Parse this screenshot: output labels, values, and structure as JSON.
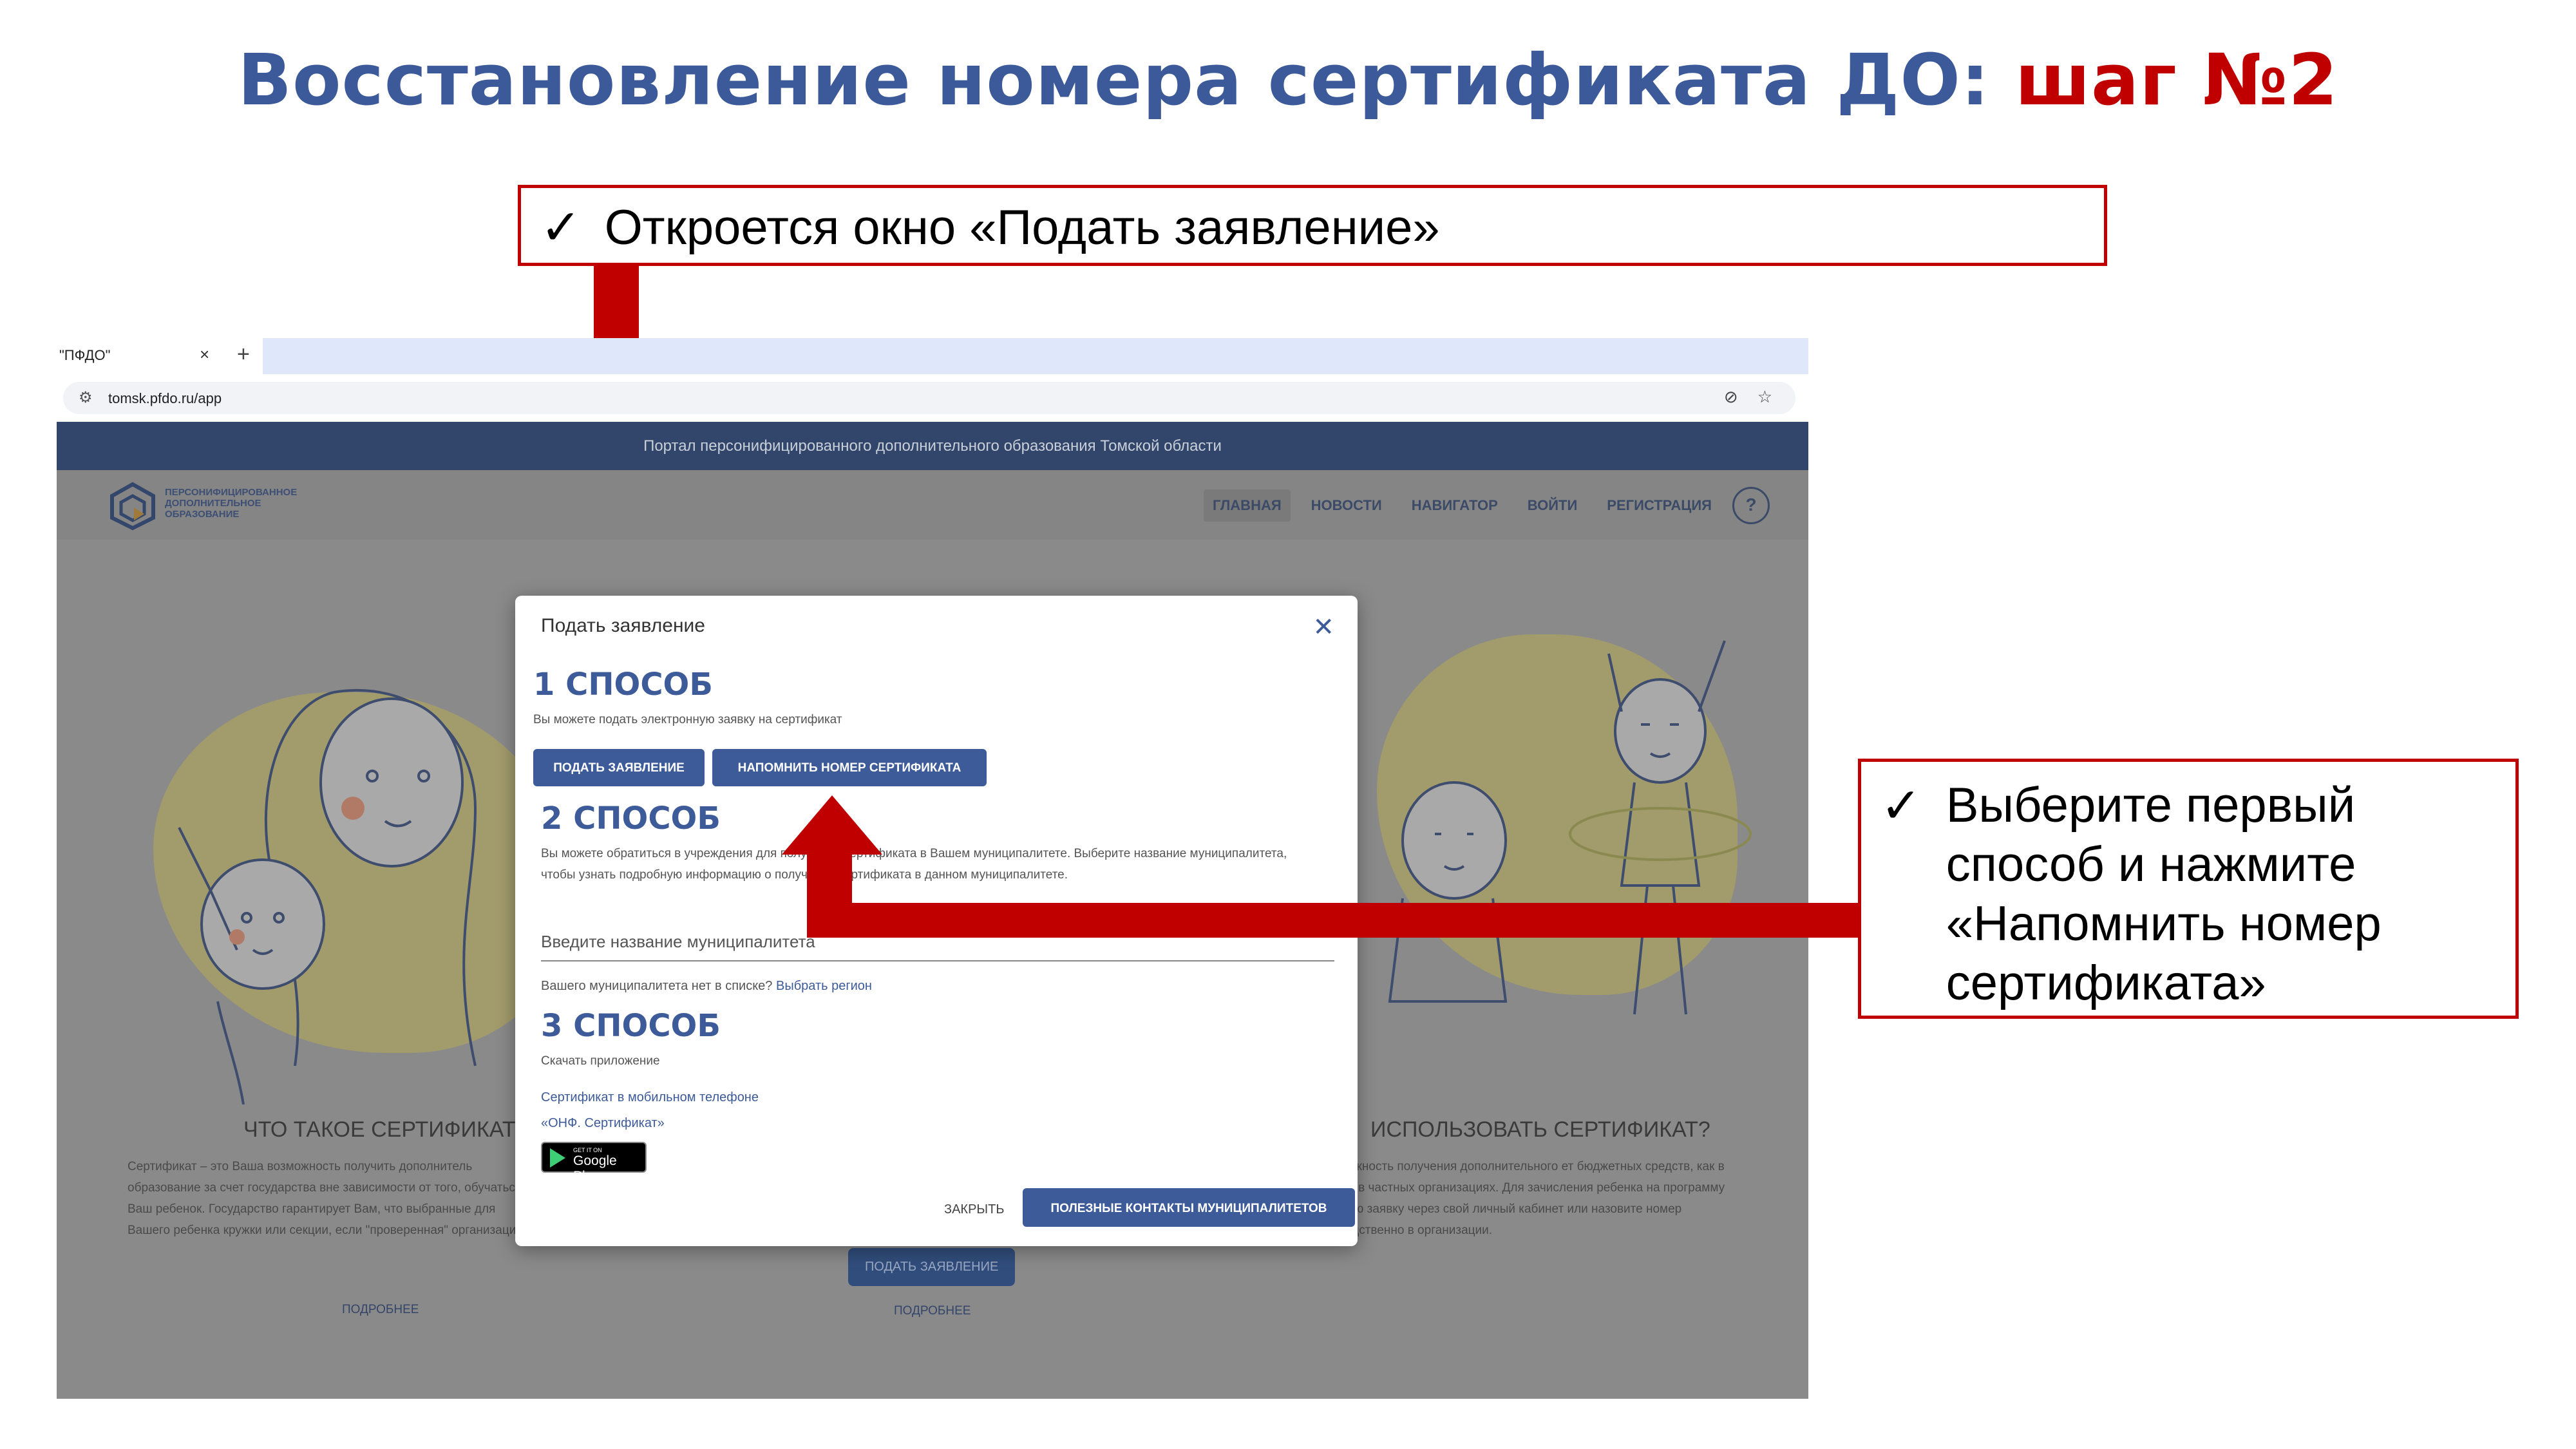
{
  "slide": {
    "title_main": "Восстановление номера сертификата ДО: ",
    "title_accent": "шаг №2",
    "callout_top": "Откроется окно «Подать заявление»",
    "callout_right": "Выберите первый способ и нажмите «Напомнить номер сертификата»",
    "check_mark": "✓",
    "accent_color": "#c00000",
    "title_color": "#3c5a9a"
  },
  "browser": {
    "tab_label": "\"ПФДО\"",
    "tab_close": "×",
    "new_tab": "+",
    "url": "tomsk.pfdo.ru/app"
  },
  "site": {
    "banner": "Портал персонифицированного дополнительного образования Томской области",
    "logo_text": "ПЕРСОНИФИЦИРОВАННОЕ ДОПОЛНИТЕЛЬНОЕ ОБРАЗОВАНИЕ",
    "nav": [
      "ГЛАВНАЯ",
      "НОВОСТИ",
      "НАВИГАТОР",
      "ВОЙТИ",
      "РЕГИСТРАЦИЯ"
    ],
    "help": "?",
    "left_section": {
      "heading": "ЧТО ТАКОЕ СЕРТИФИКАТ?",
      "text": "Сертификат – это Ваша возможность получить дополнитель образование за счет государства вне зависимости от того, обучаться Ваш ребенок. Государство гарантирует Вам, что выбранные для Вашего ребенка кружки или секции, если \"проверенная\" организация.",
      "more": "ПОДРОБНЕЕ"
    },
    "middle_section": {
      "button": "ПОДАТЬ ЗАЯВЛЕНИЕ",
      "more": "ПОДРОБНЕЕ"
    },
    "right_section": {
      "heading": "ИСПОЛЬЗОВАТЬ СЕРТИФИКАТ?",
      "text": "ставляет детям возможность получения дополнительного ет бюджетных средств, как в государственных и к и в частных организациях. Для зачисления ребенка на программу направьте электронную заявку через свой личный кабинет или назовите номер сертификата непосредственно в организации."
    }
  },
  "modal": {
    "title": "Подать заявление",
    "close": "✕",
    "way1": {
      "heading": "1 СПОСОБ",
      "text": "Вы можете подать электронную заявку на сертификат",
      "button_apply": "ПОДАТЬ ЗАЯВЛЕНИЕ",
      "button_remind": "НАПОМНИТЬ НОМЕР СЕРТИФИКАТА"
    },
    "way2": {
      "heading": "2 СПОСОБ",
      "text": "Вы можете обратиться в учреждения для получения сертификата в Вашем муниципалитете. Выберите название муниципалитета, чтобы узнать подробную информацию о получении сертификата в данном муниципалитете.",
      "placeholder": "Введите название муниципалитета",
      "not_found": "Вашего муниципалитета нет в списке?",
      "choose_region": "Выбрать регион"
    },
    "way3": {
      "heading": "3 СПОСОБ",
      "text": "Скачать приложение",
      "link_mobile": "Сертификат в мобильном телефоне",
      "link_onf": "«ОНФ. Сертификат»",
      "gp_small": "GET IT ON",
      "gp_big": "Google Play"
    },
    "footer": {
      "close": "ЗАКРЫТЬ",
      "contacts": "ПОЛЕЗНЫЕ КОНТАКТЫ МУНИЦИПАЛИТЕТОВ"
    }
  }
}
